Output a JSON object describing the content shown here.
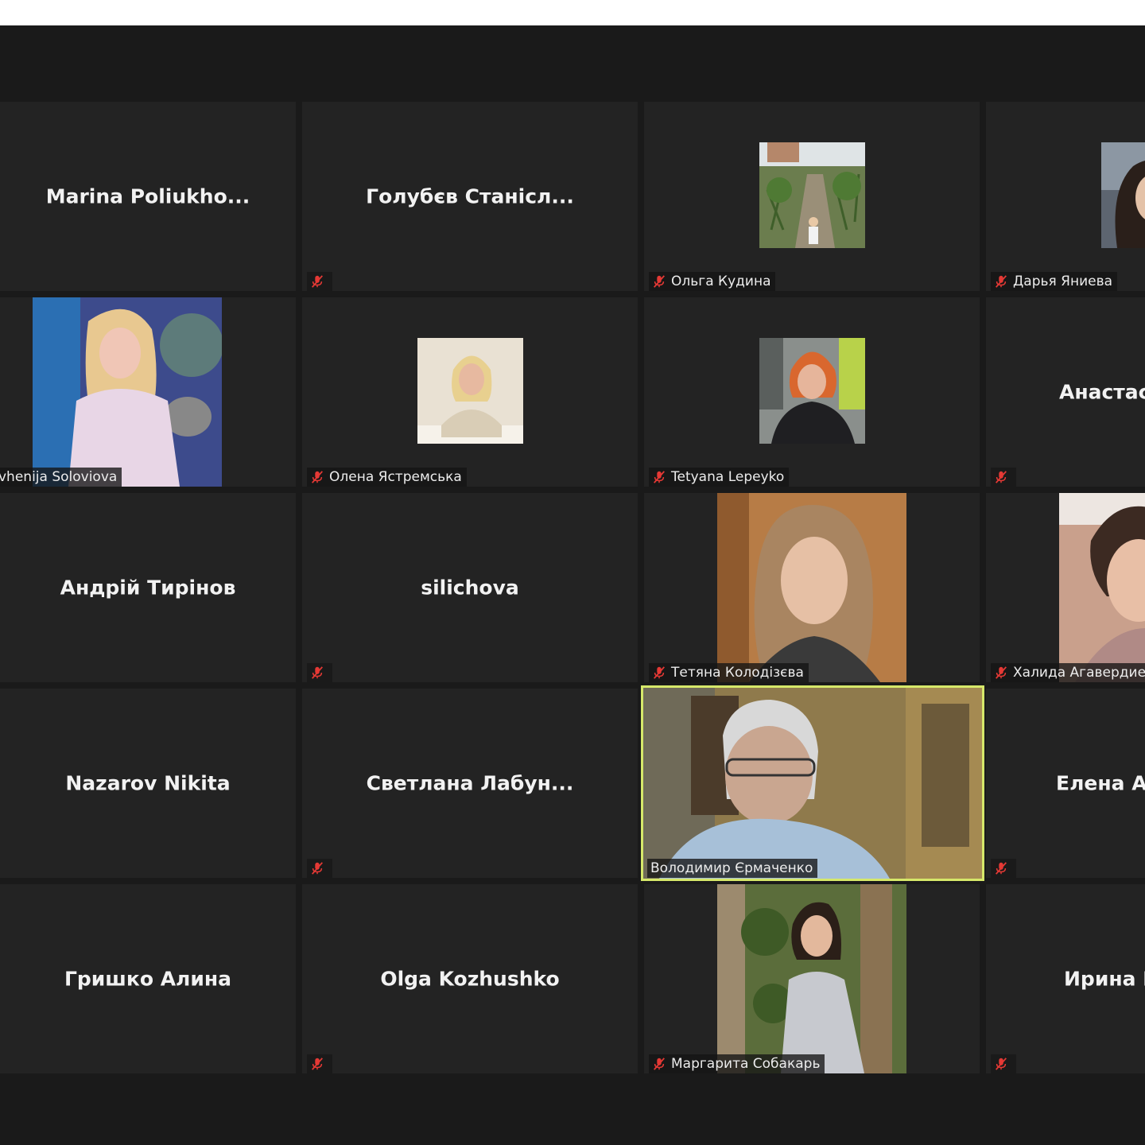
{
  "meeting": {
    "participants": [
      {
        "id": "r1c1",
        "name": "Marina  Poliukho...",
        "label": "",
        "muted": false,
        "avatar": "none"
      },
      {
        "id": "r1c2",
        "name": "Голубєв  Станісл...",
        "label": "",
        "muted": true,
        "avatar": "none"
      },
      {
        "id": "r1c3",
        "name": "",
        "label": "Ольга Кудина",
        "muted": true,
        "avatar": "photo-garden-stairs"
      },
      {
        "id": "r1c4",
        "name": "",
        "label": "Дарья Яниева",
        "muted": true,
        "avatar": "photo-woman"
      },
      {
        "id": "r2c1",
        "name": "",
        "label": "vhenija Soloviova",
        "muted": false,
        "avatar": "photo-party"
      },
      {
        "id": "r2c2",
        "name": "",
        "label": "Олена Ястремська",
        "muted": true,
        "avatar": "photo-office-desk"
      },
      {
        "id": "r2c3",
        "name": "",
        "label": "Tetyana Lepeyko",
        "muted": true,
        "avatar": "photo-office"
      },
      {
        "id": "r2c4",
        "name": "Анастас",
        "label": "",
        "muted": true,
        "avatar": "none"
      },
      {
        "id": "r3c1",
        "name": "Андрій Тирінов",
        "label": "",
        "muted": false,
        "avatar": "none"
      },
      {
        "id": "r3c2",
        "name": "silichova",
        "label": "",
        "muted": true,
        "avatar": "none"
      },
      {
        "id": "r3c3",
        "name": "",
        "label": "Тетяна Колодізєва",
        "muted": true,
        "avatar": "photo-portrait"
      },
      {
        "id": "r3c4",
        "name": "",
        "label": "Халида Агавердиева",
        "muted": true,
        "avatar": "photo-woman-smiling"
      },
      {
        "id": "r4c1",
        "name": "Nazarov Nikita",
        "label": "",
        "muted": false,
        "avatar": "none"
      },
      {
        "id": "r4c2",
        "name": "Светлана  Лабун...",
        "label": "",
        "muted": true,
        "avatar": "none"
      },
      {
        "id": "r4c3",
        "name": "",
        "label": "Володимир Єрмаченко",
        "muted": false,
        "avatar": "video-speaker",
        "speaking": true
      },
      {
        "id": "r4c4",
        "name": "Елена  А",
        "label": "",
        "muted": true,
        "avatar": "none"
      },
      {
        "id": "r5c1",
        "name": "Гришко Алина",
        "label": "",
        "muted": false,
        "avatar": "none"
      },
      {
        "id": "r5c2",
        "name": "Olga Kozhushko",
        "label": "",
        "muted": true,
        "avatar": "none"
      },
      {
        "id": "r5c3",
        "name": "",
        "label": "Маргарита Собакарь",
        "muted": true,
        "avatar": "photo-woman-plants"
      },
      {
        "id": "r5c4",
        "name": "Ирина I",
        "label": "",
        "muted": true,
        "avatar": "none"
      }
    ]
  },
  "colors": {
    "background": "#1a1a1a",
    "tile": "#232323",
    "speaking_border": "#d6e86a",
    "muted_icon": "#e53935"
  }
}
